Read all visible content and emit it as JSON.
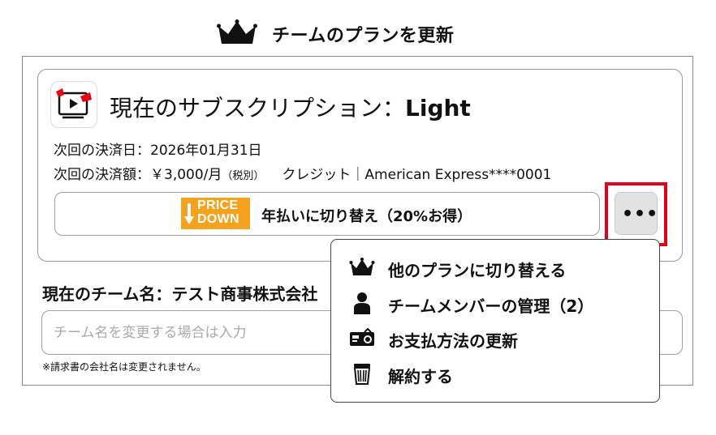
{
  "page": {
    "title": "チームのプランを更新"
  },
  "subscription": {
    "prefix": "現在のサブスクリプション：",
    "plan": "Light",
    "next_date_label": "次回の決済日：",
    "next_date": "2026年01月31日",
    "next_amount_label": "次回の決済額：",
    "next_amount": "￥3,000/月",
    "tax_note": "（税別）",
    "payment_method": "クレジット｜American Express****0001"
  },
  "switch_button": {
    "badge_line1": "PRICE",
    "badge_line2": "DOWN",
    "label": "年払いに切り替え（20%お得）"
  },
  "more_button": {
    "label": "•••"
  },
  "team": {
    "label": "現在のチーム名：テスト商事株式会社",
    "input_value": "",
    "input_placeholder": "チーム名を変更する場合は入力",
    "note": "※請求書の会社名は変更されません。"
  },
  "menu": {
    "items": [
      {
        "icon": "crown-icon",
        "label": "他のプランに切り替える"
      },
      {
        "icon": "person-icon",
        "label": "チームメンバーの管理（2）"
      },
      {
        "icon": "payment-card-icon",
        "label": "お支払方法の更新"
      },
      {
        "icon": "trash-icon",
        "label": "解約する"
      }
    ]
  },
  "colors": {
    "highlight": "#e0001b",
    "badge": "#f5a31c",
    "logo_red": "#e60012"
  }
}
